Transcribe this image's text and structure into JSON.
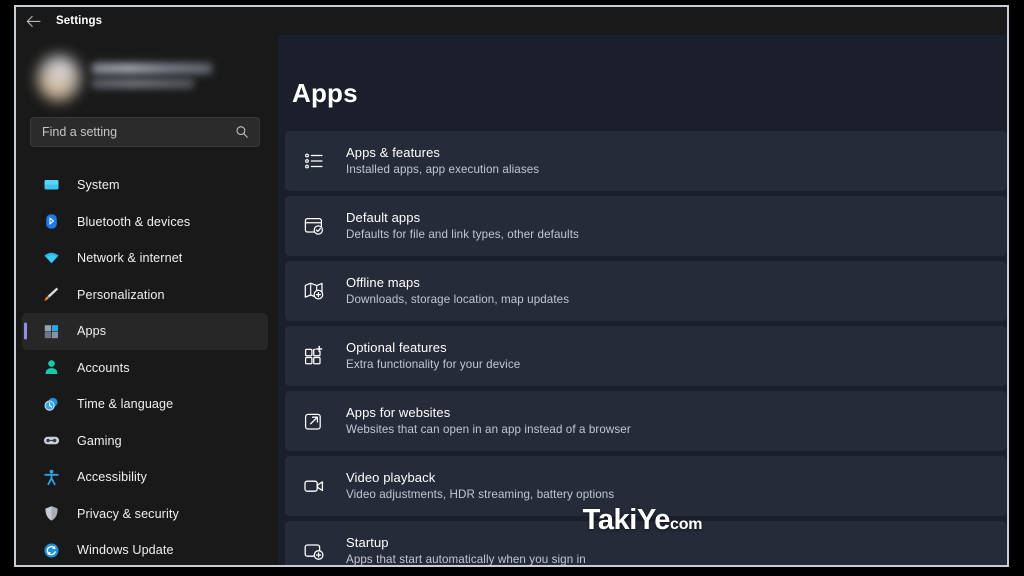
{
  "window": {
    "title": "Settings",
    "back_icon": "back-arrow-icon"
  },
  "sidebar": {
    "profile": {
      "name_redacted": "",
      "email_redacted": "",
      "avatar_icon": "user-avatar"
    },
    "search": {
      "placeholder": "Find a setting",
      "value": "",
      "icon": "search-icon"
    },
    "items": [
      {
        "label": "System",
        "icon": "monitor-icon",
        "selected": false
      },
      {
        "label": "Bluetooth & devices",
        "icon": "bluetooth-icon",
        "selected": false
      },
      {
        "label": "Network & internet",
        "icon": "wifi-icon",
        "selected": false
      },
      {
        "label": "Personalization",
        "icon": "paintbrush-icon",
        "selected": false
      },
      {
        "label": "Apps",
        "icon": "apps-grid-icon",
        "selected": true
      },
      {
        "label": "Accounts",
        "icon": "person-icon",
        "selected": false
      },
      {
        "label": "Time & language",
        "icon": "clock-icon",
        "selected": false
      },
      {
        "label": "Gaming",
        "icon": "gamepad-icon",
        "selected": false
      },
      {
        "label": "Accessibility",
        "icon": "accessibility-icon",
        "selected": false
      },
      {
        "label": "Privacy & security",
        "icon": "shield-icon",
        "selected": false
      },
      {
        "label": "Windows Update",
        "icon": "update-refresh-icon",
        "selected": false
      }
    ]
  },
  "main": {
    "title": "Apps",
    "cards": [
      {
        "title": "Apps & features",
        "subtitle": "Installed apps, app execution aliases",
        "icon": "bulleted-list-icon"
      },
      {
        "title": "Default apps",
        "subtitle": "Defaults for file and link types, other defaults",
        "icon": "window-check-icon"
      },
      {
        "title": "Offline maps",
        "subtitle": "Downloads, storage location, map updates",
        "icon": "map-pin-icon"
      },
      {
        "title": "Optional features",
        "subtitle": "Extra functionality for your device",
        "icon": "grid-plus-icon"
      },
      {
        "title": "Apps for websites",
        "subtitle": "Websites that can open in an app instead of a browser",
        "icon": "open-external-icon"
      },
      {
        "title": "Video playback",
        "subtitle": "Video adjustments, HDR streaming, battery options",
        "icon": "video-camera-icon"
      },
      {
        "title": "Startup",
        "subtitle": "Apps that start automatically when you sign in",
        "icon": "startup-plus-icon"
      }
    ]
  },
  "watermark": {
    "main": "TakiYe",
    "suffix": "com"
  },
  "colors": {
    "sidebar_bg": "#191919",
    "main_bg": "#1b1f2b",
    "card_bg": "#262b39",
    "selection_accent": "#8f8fe8",
    "frame_border": "#c9cdd6"
  }
}
